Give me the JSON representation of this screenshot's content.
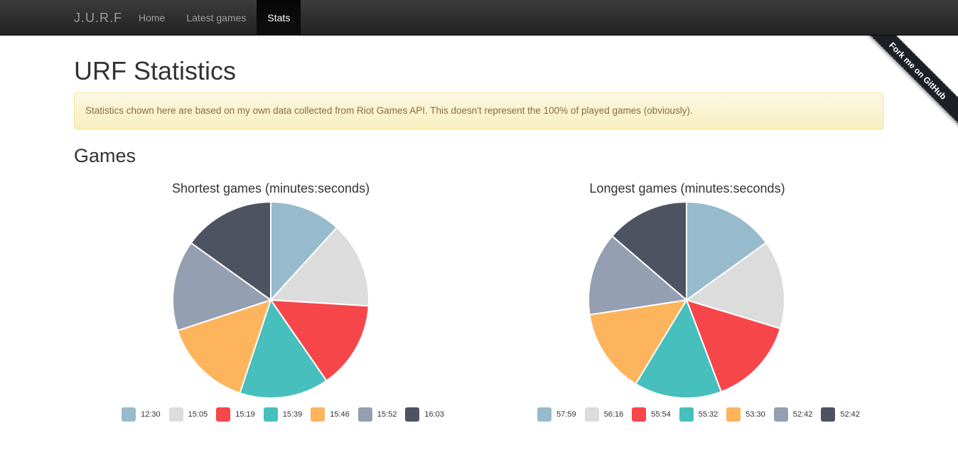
{
  "navbar": {
    "brand": "J.U.R.F",
    "items": [
      {
        "label": "Home",
        "active": false
      },
      {
        "label": "Latest games",
        "active": false
      },
      {
        "label": "Stats",
        "active": true
      }
    ]
  },
  "ribbon": {
    "label": "Fork me on GitHub"
  },
  "page": {
    "title": "URF Statistics",
    "alert": "Statistics chown here are based on my own data collected from Riot Games API. This doesn't represent the 100% of played games (obviously).",
    "section_title": "Games"
  },
  "colors": {
    "slices": [
      "#97bbcd",
      "#dcdcdc",
      "#f7464a",
      "#46bfbd",
      "#fdb45c",
      "#949fb1",
      "#4d5360"
    ],
    "alert_text": "#8a6d3b",
    "navbar": "#222222"
  },
  "chart_data": [
    {
      "type": "pie",
      "title": "Shortest games (minutes:seconds)",
      "categories": [
        "12:30",
        "15:05",
        "15:19",
        "15:39",
        "15:46",
        "15:52",
        "16:03"
      ],
      "values": [
        750,
        905,
        919,
        939,
        946,
        952,
        963
      ],
      "legend": "bottom"
    },
    {
      "type": "pie",
      "title": "Longest games (minutes:seconds)",
      "categories": [
        "57:59",
        "56:16",
        "55:54",
        "55:32",
        "53:30",
        "52:42",
        "52:42"
      ],
      "values": [
        3479,
        3376,
        3354,
        3332,
        3210,
        3162,
        3162
      ],
      "legend": "bottom"
    }
  ]
}
